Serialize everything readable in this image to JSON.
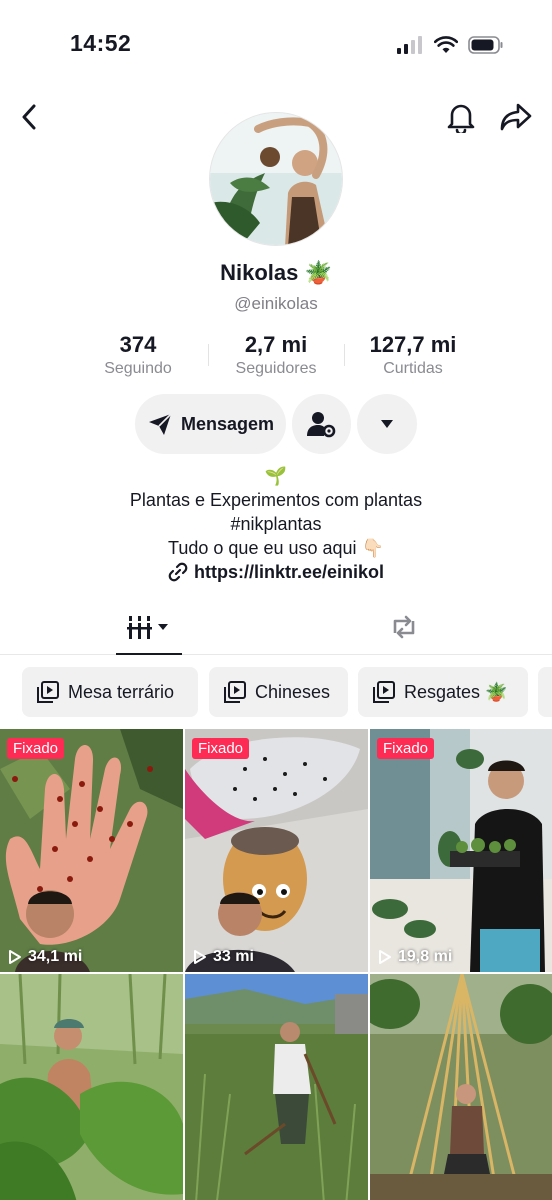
{
  "status_bar": {
    "time": "14:52"
  },
  "nav": {
    "back_icon": "chevron-left-icon",
    "bell_icon": "bell-icon",
    "share_icon": "share-arrow-icon"
  },
  "profile": {
    "name": "Nikolas",
    "name_emoji": "🪴",
    "handle": "@einikolas"
  },
  "stats": [
    {
      "value": "374",
      "label": "Seguindo"
    },
    {
      "value": "2,7 mi",
      "label": "Seguidores"
    },
    {
      "value": "127,7 mi",
      "label": "Curtidas"
    }
  ],
  "actions": {
    "message_label": "Mensagem"
  },
  "bio": {
    "emoji": "🌱",
    "line1": "Plantas e Experimentos com plantas",
    "line2": "#nikplantas",
    "line3": "Tudo o que eu uso aqui 👇🏻",
    "link": "https://linktr.ee/einikol"
  },
  "tabs": {
    "active": "videos",
    "items": [
      "videos-grid-icon",
      "reposts-icon"
    ]
  },
  "playlists": [
    {
      "label": "Mesa terrário"
    },
    {
      "label": "Chineses"
    },
    {
      "label": "Resgates 🪴"
    }
  ],
  "videos": [
    {
      "pinned": "Fixado",
      "views": "34,1 mi"
    },
    {
      "pinned": "Fixado",
      "views": "33 mi"
    },
    {
      "pinned": "Fixado",
      "views": "19,8 mi"
    },
    {
      "pinned": "",
      "views": ""
    },
    {
      "pinned": "",
      "views": ""
    },
    {
      "pinned": "",
      "views": ""
    }
  ],
  "colors": {
    "accent_red": "#fe2c55",
    "button_bg": "#f1f1f2",
    "text_primary": "#161823",
    "text_secondary": "#8a8b91"
  }
}
